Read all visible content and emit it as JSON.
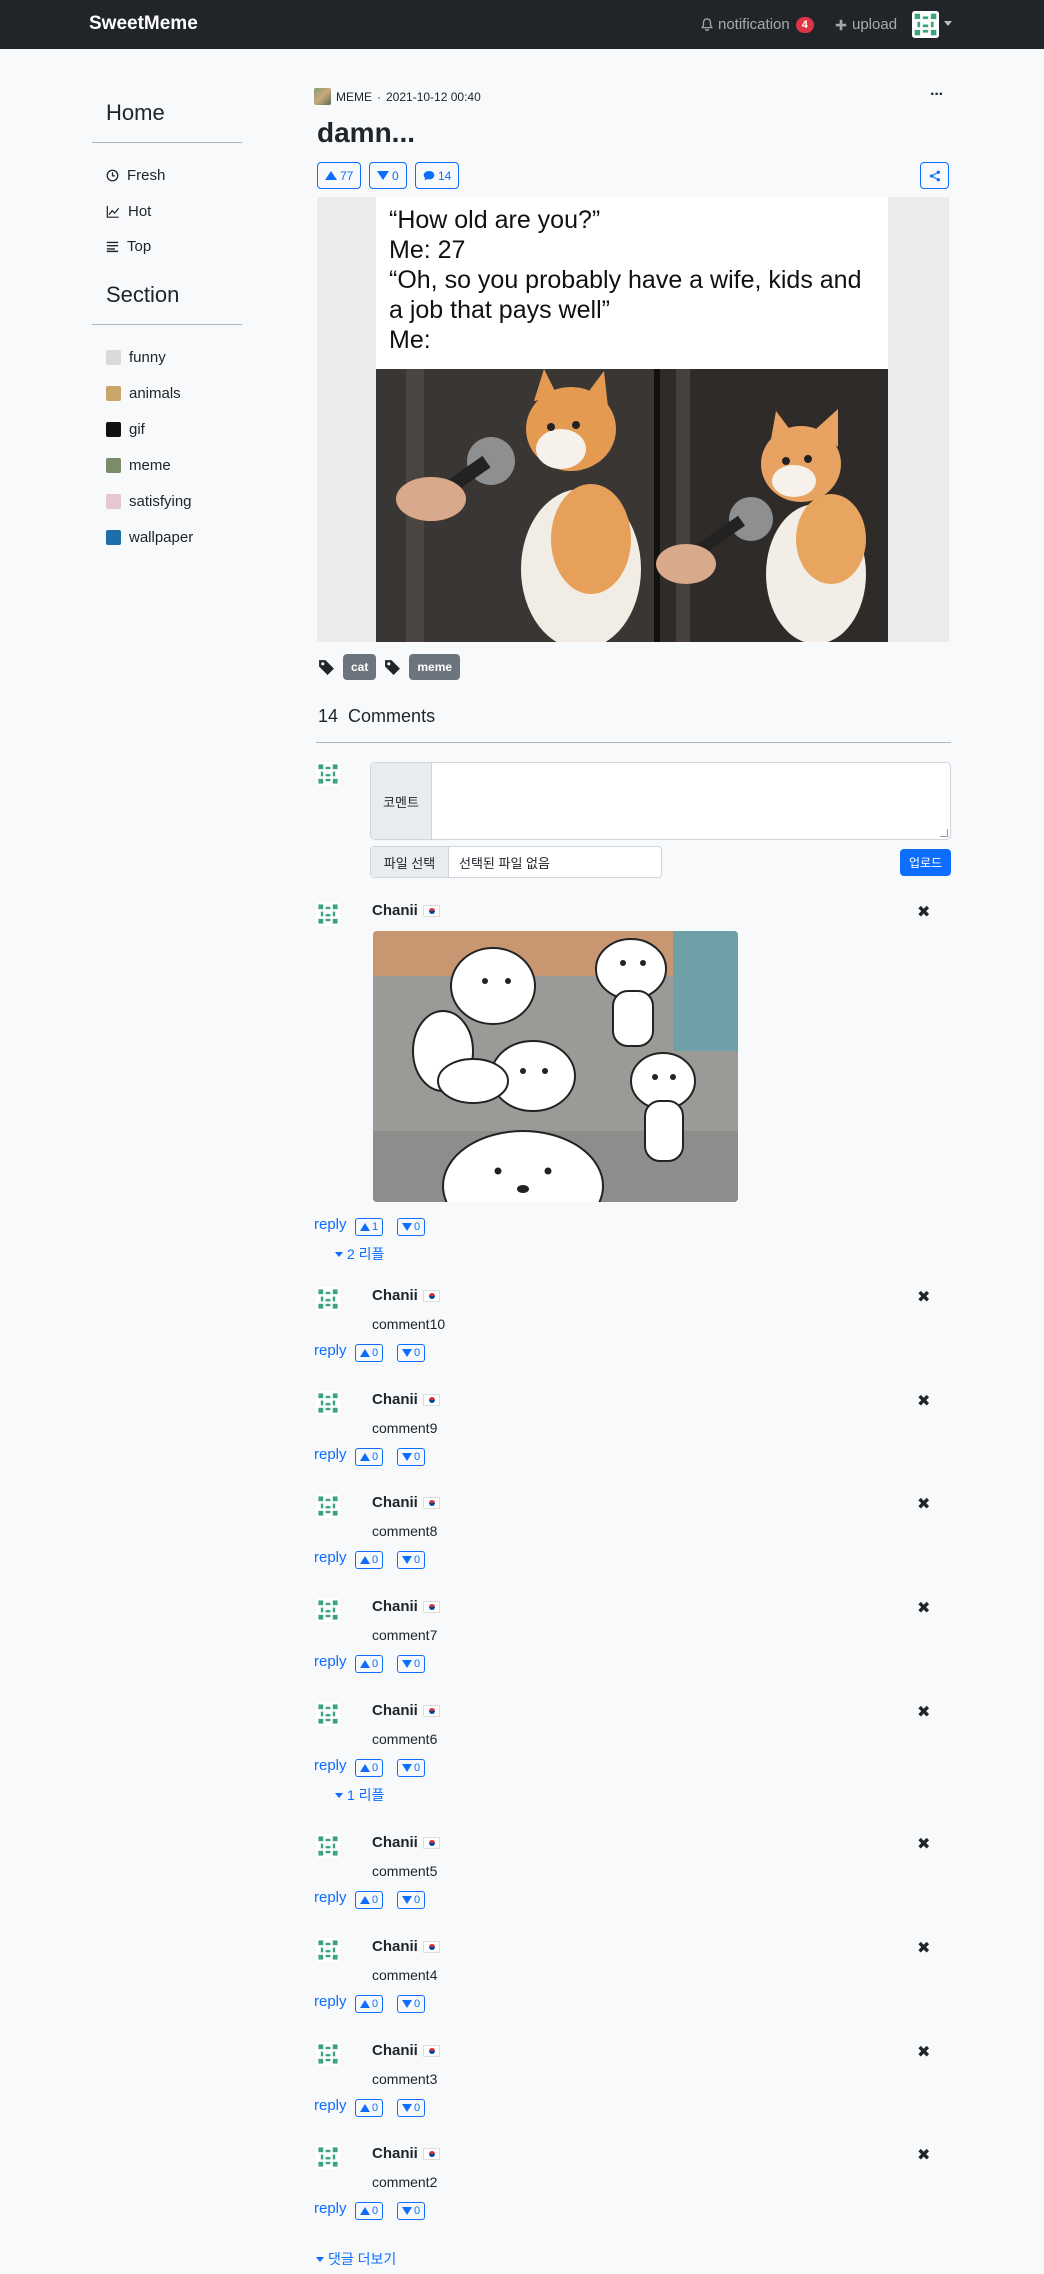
{
  "navbar": {
    "brand": "SweetMeme",
    "notification_label": "notification",
    "notification_count": "4",
    "upload_label": "upload"
  },
  "sidebar": {
    "home_heading": "Home",
    "home_items": [
      {
        "label": "Fresh",
        "icon": "clock-icon"
      },
      {
        "label": "Hot",
        "icon": "chart-line-icon"
      },
      {
        "label": "Top",
        "icon": "list-icon"
      }
    ],
    "section_heading": "Section",
    "section_items": [
      {
        "label": "funny",
        "color": "#d9d9d9"
      },
      {
        "label": "animals",
        "color": "#c9a56a"
      },
      {
        "label": "gif",
        "color": "#111111"
      },
      {
        "label": "meme",
        "color": "#7b8b6b"
      },
      {
        "label": "satisfying",
        "color": "#e6c6cf"
      },
      {
        "label": "wallpaper",
        "color": "#1d6fa8"
      }
    ]
  },
  "post": {
    "section": "MEME",
    "date": "2021-10-12 00:40",
    "more": "···",
    "title": "damn...",
    "upvotes": "77",
    "downvotes": "0",
    "comments_count": "14",
    "meme_text": "“How old are you?”\nMe: 27\n“Oh, so you probably have a wife, kids and\na job that pays well”\nMe:",
    "tags": [
      "cat",
      "meme"
    ]
  },
  "comments_section": {
    "count": "14",
    "heading": "Comments",
    "form_label": "코멘트",
    "file_button": "파일 선택",
    "file_placeholder": "선택된 파일 없음",
    "upload_button": "업로드",
    "reply_label": "reply",
    "load_more": "댓글 더보기"
  },
  "comments": [
    {
      "user": "Chanii",
      "text": "",
      "up": "1",
      "down": "0",
      "replies": "2 리플",
      "has_gif": true
    },
    {
      "user": "Chanii",
      "text": "comment10",
      "up": "0",
      "down": "0",
      "replies": ""
    },
    {
      "user": "Chanii",
      "text": "comment9",
      "up": "0",
      "down": "0",
      "replies": ""
    },
    {
      "user": "Chanii",
      "text": "comment8",
      "up": "0",
      "down": "0",
      "replies": ""
    },
    {
      "user": "Chanii",
      "text": "comment7",
      "up": "0",
      "down": "0",
      "replies": ""
    },
    {
      "user": "Chanii",
      "text": "comment6",
      "up": "0",
      "down": "0",
      "replies": "1 리플"
    },
    {
      "user": "Chanii",
      "text": "comment5",
      "up": "0",
      "down": "0",
      "replies": ""
    },
    {
      "user": "Chanii",
      "text": "comment4",
      "up": "0",
      "down": "0",
      "replies": ""
    },
    {
      "user": "Chanii",
      "text": "comment3",
      "up": "0",
      "down": "0",
      "replies": ""
    },
    {
      "user": "Chanii",
      "text": "comment2",
      "up": "0",
      "down": "0",
      "replies": ""
    }
  ],
  "colors": {
    "navbar_bg": "#212529",
    "accent": "#0d6efd",
    "badge": "#dc3545",
    "tag": "#6c757d"
  }
}
